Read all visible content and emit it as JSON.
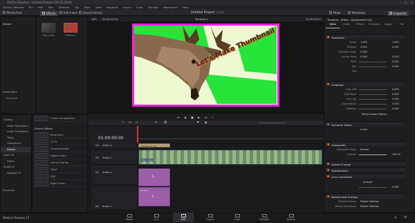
{
  "window": {
    "title": "DaVinci Resolve - Untitled Project (26.12.2024)",
    "controls": [
      "–",
      "□",
      "✕"
    ]
  },
  "menu": [
    "DaVinci Resolve",
    "File",
    "Edit",
    "Trim",
    "Timeline",
    "Clip",
    "Mark",
    "View",
    "Playback",
    "Fusion",
    "Color",
    "Fairlight",
    "Workspace",
    "Help"
  ],
  "toolbar": {
    "media_pool": "Media Pool",
    "effects": "Effects",
    "edit_index": "Edit Index",
    "sound_library": "Sound Library",
    "project_title": "Untitled Project",
    "edited_label": "Edited",
    "mixer": "Mixer",
    "metadata": "Metadata",
    "inspector": "Inspector"
  },
  "viewer": {
    "zoom": "16%",
    "timecode_left": "00:00:02:04",
    "timeline_name": "Timeline 1",
    "timecode_right": "01:00:20:22",
    "overlay_text": "Let's Make Thumbnail"
  },
  "media_pool": {
    "bin": "Master",
    "clips": [
      {
        "name": "Clip_1.mp4"
      },
      {
        "name": "Timeline 1"
      }
    ],
    "smart_bins": "Smart Bins",
    "keywords": "Keywords"
  },
  "effects_tree": {
    "items": [
      "Toolbox",
      "Video Transitions",
      "Audio Transitions",
      "Titles",
      "Generators",
      "Effects",
      "Open FX",
      "Filters",
      "Audio FX",
      "Fairlight FX"
    ],
    "selected": "Effects",
    "favorites": "Favorites"
  },
  "effects_list": {
    "header": "Fusion Effects",
    "top_item": "Fusion Composition",
    "items": [
      "Binoculars",
      "CCTV",
      "Colored Border",
      "Digital Glitch",
      "Drone Overlay",
      "DSLR",
      "DVE",
      "Night Vision"
    ]
  },
  "timeline": {
    "timecode": "01:00:00:00",
    "tracks": [
      {
        "id": "V3",
        "name": "Video 3",
        "clips": 0
      },
      {
        "id": "V2",
        "name": "Video 2",
        "clips": 1
      },
      {
        "id": "V1",
        "name": "Video 1",
        "clips": 1
      },
      {
        "id": "A1",
        "name": "Audio 1",
        "clips": 1
      }
    ],
    "adjustment_clip": "Adjustment Clip",
    "video_clip_label": "Clip_1.mp4",
    "audio_clip_label": "Audio 1"
  },
  "inspector": {
    "title": "Timeline - Effect - Adjustment Clip",
    "tabs": [
      "Video",
      "Audio",
      "Effects",
      "Transition",
      "Image",
      "File"
    ],
    "transform": "Transform",
    "zoom_x": "1.000",
    "zoom_y": "1.000",
    "position_x": "0.000",
    "position_y": "0.000",
    "rotation": "0.000",
    "anchor_x": "0.000",
    "anchor_y": "0.000",
    "pitch": "0.000",
    "yaw": "0.000",
    "flip": "Flip",
    "labels": {
      "zoom": "Zoom",
      "position": "Position",
      "rotation": "Rotation Angle",
      "anchor": "Anchor Point",
      "pitch": "Pitch",
      "yaw": "Yaw",
      "crop_left": "Crop Left",
      "crop_right": "Crop Right",
      "crop_top": "Crop Top",
      "crop_bottom": "Crop Bottom",
      "softness": "Softness",
      "composite_mode": "Composite Mode",
      "opacity": "Opacity",
      "detection": "Detection",
      "resize_process": "Retime Process",
      "motion_estimation": "Motion Estimation"
    },
    "cropping": "Cropping",
    "crop_left": "0.000",
    "crop_right": "0.000",
    "crop_top": "0.000",
    "crop_bottom": "0.000",
    "softness": "0.000",
    "retain_image_position": "Retain Image Position",
    "dynamic_zoom": "Dynamic Zoom",
    "dynamic_zoom_ease": "Linear",
    "composite": "Composite",
    "composite_mode": "Normal",
    "opacity": "100.00",
    "speed_change": "Speed Change",
    "stabilization": "Stabilization",
    "lens_correction": "Lens Correction",
    "analyze": "Analyze",
    "distortion": "0.000",
    "retime_scaling": "Retime and Scaling",
    "retime_process": "Project Settings",
    "motion_estimation": "Project Settings"
  },
  "pages": [
    "Media",
    "Cut",
    "Edit",
    "Fusion",
    "Color",
    "Fairlight",
    "Deliver"
  ],
  "active_page": "Edit",
  "app_brand": "DaVinci Resolve 17",
  "colors": {
    "accent": "#ff6b1a",
    "magenta_border": "#ff1ee6",
    "green_bg": "#26e43a",
    "red_playhead": "#e0353b"
  }
}
